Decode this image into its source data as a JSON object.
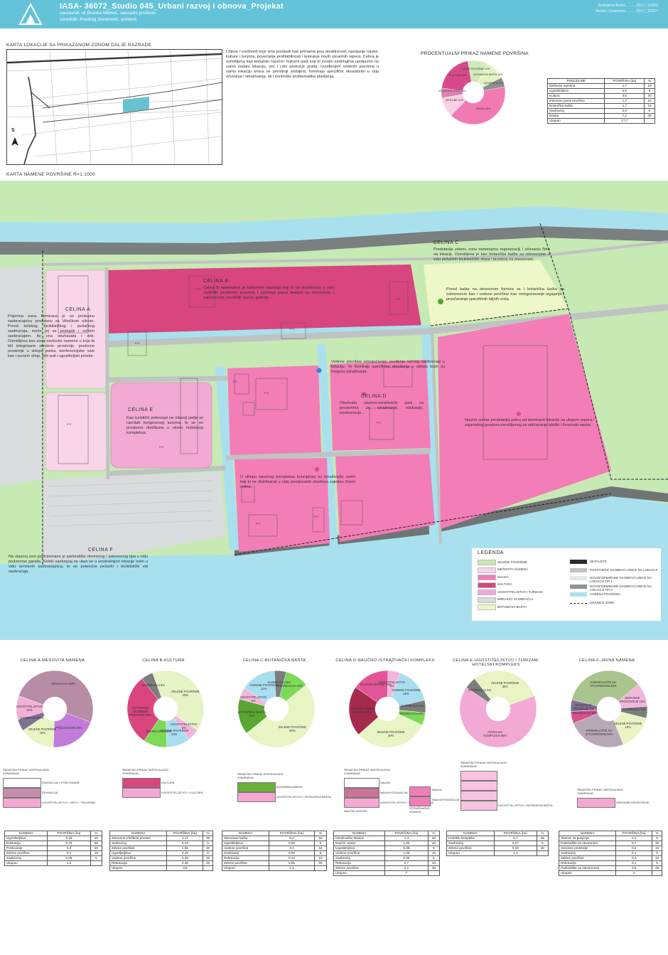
{
  "header": {
    "title": "IASA- 36072_Studio 045_Urbani razvoj i obnova_Projekat",
    "mentor": "nastavnik: dr Branko Mitović, vanredni profesor",
    "assistant": "saradnik: Predrag Jovanović, asistent",
    "author1": "Andrijana Đukić..........2017_12003",
    "author2": "Teodor Jovanović..........2017_12017"
  },
  "section_location": {
    "title": "KARTA LOKACIJE SA PRIKAZANOM ZONOM DALJE RAZRADE",
    "north": "S"
  },
  "intro_text": "Ciljeve i vrednosti koje smo postavili kao primarne jesu atraktivnost, razvijanje nauke, kulture i turizma, povećanje profitabilnosti i kreiranje novih vizuelnih repera. Celina je osmišljena kao tematski naučno- kulturni park koji bi svojim sadržajima upotpunio ne samo zadatu lokaciju, već i celo područje grada. Uvođenjem vodenih površina u samu lokaciju kreira se prirodniji ambijent; formiraju specifični ekosistemi u cilju očuvanja i istraživanja, ali i kontrolše problematika plavljenja.",
  "chart_data": [
    {
      "type": "pie",
      "id": "overall",
      "title": "PROCENTUALNI PRIKAZ NAMENE POVRŠINA",
      "categories": [
        "JAVNE POVRŠINE",
        "BOTANIČKA BAŠTA",
        "SAOBRAĆAJ",
        "NAUKA",
        "MEŠ.UBE",
        "UGOSTITELJSTVO",
        "KULTURA"
      ],
      "values": [
        10,
        10,
        5,
        40,
        10,
        5,
        20
      ],
      "labels": [
        "JAVNE POVRŠINE 10%",
        "BOTANIČKA BAŠTA 10%",
        "SAOBRAĆAJ 5%",
        "NAUKA 40%",
        "MEŠ.UBE 10%",
        "UGOSTITELJSTVO 5%",
        "KULTURA 20%"
      ],
      "colors": [
        "#d3e9b8",
        "#e4f3c4",
        "#8e8f8f",
        "#f27ab3",
        "#f7d0e4",
        "#e07fb0",
        "#d64a8b"
      ]
    },
    {
      "type": "pie",
      "id": "a",
      "title": "CELINA A-MEŠOVITA NAMENA",
      "categories": [
        "EDUKACIJA",
        "POSLOVANJE",
        "ZELENE POVRŠINE",
        "SAOBRAĆAJ",
        "UGOSTITELJSTVO"
      ],
      "values": [
        50,
        20,
        15,
        5,
        10
      ],
      "labels": [
        "EDUKACIJA 50%",
        "POSLOVANJE 20%",
        "ZELENE POVRŠINE 15%",
        "SAOBRAĆAJ 5%",
        "UGOSTITELJSTVO 10%"
      ],
      "colors": [
        "#b78ca5",
        "#c07cd8",
        "#e8f4c3",
        "#7e6f95",
        "#f1b1d7"
      ]
    },
    {
      "type": "pie",
      "id": "b",
      "title": "CELINA B-KULTURA",
      "categories": [
        "ZELENE POVRŠINE",
        "UGOSTITELJSTVO",
        "VODENE POVRŠINE",
        "REKREACIJA",
        "ZATVORENI IZLOŽBENI PROSTORI",
        "SAOBRAĆAJ"
      ],
      "values": [
        40,
        5,
        10,
        10,
        30,
        5
      ],
      "labels": [
        "ZELENE POVRŠINE 40%",
        "UGOSTITELJSTVO 5%",
        "VODENE POVRŠINE 10%",
        "REKREACIJA 10%",
        "ZATVORENI IZLOŽBENI PROSTORI 30%",
        "SAOBRAĆAJ 5%"
      ],
      "colors": [
        "#e6f3c4",
        "#f2b6dd",
        "#a8def0",
        "#7ed957",
        "#d9457f",
        "#7c7d7d"
      ]
    },
    {
      "type": "pie",
      "id": "c",
      "title": "CELINA C-BOTANIČKA BAŠTA",
      "categories": [
        "REKREACIJA",
        "ZELENE POVRŠINE",
        "ZATVORENA BAŠTA",
        "UGOSTITELJSTVO",
        "VODENE POVRŠINE",
        "SAOBRAĆAJ"
      ],
      "values": [
        10,
        50,
        15,
        5,
        15,
        5
      ],
      "labels": [
        "REKREACIJA 10%",
        "ZELENE POVRŠINE 50%",
        "ZATVORENA BAŠTA 15%",
        "UGOSTITELJSTVO 5%",
        "VODENE POVRŠINE 15%",
        "SAOBRAĆAJ 5%"
      ],
      "colors": [
        "#7ed957",
        "#e8f4c3",
        "#5aa632",
        "#f2b6dd",
        "#a8def0",
        "#7c7d7d"
      ]
    },
    {
      "type": "pie",
      "id": "d",
      "title": "CELINA D-NAUČNO-ISTRAŽIVAČKI KOMPLEKS",
      "categories": [
        "VODENE POVRŠINE",
        "SAOBRAĆAJ",
        "REKREACIJA",
        "ZELENE POVRŠINE",
        "ISTRAŽIVAČKE STANICE",
        "NAUČNI CENTAR",
        "UGOSTITELJSTVO"
      ],
      "values": [
        15,
        5,
        5,
        30,
        20,
        15,
        5
      ],
      "labels": [
        "VODENE POVRŠINE 15%",
        "SAOBRAĆAJ 5%",
        "REKREACIJA 5%",
        "ZELENE POVRŠINE 30%",
        "ISTRAŽIVAČKE STANICE 20%",
        "NAUČNI CENTAR 15%",
        "UGOSTITELJSTVO 5%"
      ],
      "colors": [
        "#a8def0",
        "#7c7d7d",
        "#7ed957",
        "#e8f4c3",
        "#a52a4e",
        "#e35597",
        "#f2b6dd"
      ]
    },
    {
      "type": "pie",
      "id": "e",
      "title": "CELINA E-UGOSTITELJSTVO I TURIZAM-HOTELSKI KOMPLEKS",
      "categories": [
        "HOTELSKI KOMPLEKS",
        "SAOBRAĆAJ",
        "ZELENE POVRŠINE"
      ],
      "values": [
        65,
        5,
        30
      ],
      "labels": [
        "HOTELSKI KOMPLEKS 65%",
        "SAOBRAĆAJ 5%",
        "ZELENE POVRŠINE 30%"
      ],
      "colors": [
        "#f2a9d4",
        "#7c7d7d",
        "#e8f4c3"
      ]
    },
    {
      "type": "pie",
      "id": "f",
      "title": "CELINA F-JAVNA NAMENA",
      "categories": [
        "SERVISNE PROSTORIJE",
        "SAOBRAĆAJ",
        "ZELENE POVRŠINE",
        "PARKIRALIŠTE NA ZATVORENOM",
        "REKREACIJA",
        "STANICE ZA PUNJENJE",
        "PARKIRALIŠTE NA OTVORENOM"
      ],
      "values": [
        10,
        5,
        15,
        25,
        5,
        5,
        35
      ],
      "labels": [
        "SERVISNE PROSTORIJE 10%",
        "SAOBRAĆAJ 5%",
        "ZELENE POVRŠINE 15%",
        "PARKIRALIŠTE NA ZATVORENOM 25%",
        "REKREACIJA 5%",
        "STANICE ZA PUNJENJE 5%",
        "PARKIRALIŠTE NA OTVORENOM 40%"
      ],
      "colors": [
        "#f2b6dd",
        "#7c7d7d",
        "#e8f4c3",
        "#b7a8b7",
        "#d74f8d",
        "#7e6f95",
        "#a9c48d"
      ]
    }
  ],
  "overall_table": {
    "headers": [
      "PODCELINE",
      "POVRŠINA (ha)",
      "%"
    ],
    "rows": [
      [
        "Mešovita namena",
        "1,7",
        "10"
      ],
      [
        "Ugostiteljstvo",
        "0,9",
        "5"
      ],
      [
        "Kultura",
        "3,6",
        "20"
      ],
      [
        "Otvorene javne površine",
        "1,7",
        "10"
      ],
      [
        "Botanička bašta",
        "1,7",
        "10"
      ],
      [
        "Saobraćaj",
        "0,9",
        "5"
      ],
      [
        "Nauka",
        "7,2",
        "40"
      ],
      [
        "Ukupno",
        "17,7",
        ""
      ]
    ]
  },
  "section_map": {
    "title": "KARTA NAMENE POVRŠINE R=1:1000"
  },
  "zones": {
    "a": {
      "title": "CELINA A",
      "text": "Prijemna zona formirana je uz pristupnu saobraćajnicu povezanu sa Vilničkom ulicom. Pored kolskog, biciklističkog i pešačkog saobraćaja, može joj se pristupiti i rečnim saobraćajem. Ite ona obuhavata i dok. Osmišljena kao zona mešovite namene u koju bi bili integrisane servisne prostorije, poslovne prostorije u sklopu parka, konferencijske sale kao i suvenir shop, info pult i ugostiteljski prostor."
    },
    "b": {
      "title": "CELINA B",
      "text": "Celina B namenjena je kulturnom sadržaju koji bi se distribuirao u vidu različitih izložbenih prostora i sadržaja poput teatara na otvorenom i zatvorenom, muzičkih scena, galerija..."
    },
    "c": {
      "title": "CELINA C",
      "text": "Predstavlja zelenu zonu namenjenu regeneraciji i očuvanju flore na lokaciji. Osmišljena je kao botanička bašta sa rekreacijom u vidu pešačkih biciklističkih staza i prostora na otvorenom.",
      "text2": "Pored bašte na otvorenom formira se i botanička bašta na zatvorenom kao i vodene površine kao omogućavanje izgajanje i proučavanje specifičnih biljnih vrsta."
    },
    "d": {
      "title": "CELINA D",
      "text": "Obuhvata naučno-istraživački park sa prostorima za istraživanje, edukaciju, konferencije...",
      "text2": "Vodene površine omogućavaju uvođenje rečnog saobraćaja u lokaciju. Te formiraju specifična okruženja u sklopu kojih su moguća istraživanja.",
      "text3": "U sklopu naučnog kompleksa koncipirani su istraživački centri koji bi se distribuirali u vidu paviljonskih struktura zajedno čineći celinu.",
      "text4": "Naučni centar predstavlja jednu od dominanti lokacije sa ulogom repera i sajamskog prostora osmišljenog za održavanje izložbi i Festivala nauke."
    },
    "e": {
      "title": "CELINA E",
      "text": "Kao turistički potencijal na lokaciji javlja se razvitak kongresnog turizma, te se on prostorno distribuira u okviru hotelskog kompleksa."
    },
    "f": {
      "title": "CELINA F",
      "text": "Na ulaznoj zoni pozicionirane je parkiralište otvorenog i zatvorenog tipa u vidu podzemne garaže. Kolski saobraćaj ne ulazi se u unutrašnjost lokacije osim u vidu servisnih saobraćajnica, te se potencira pešački i biciklistički vid saobraćaja."
    }
  },
  "map_labels": {
    "p1": "P+1",
    "p2": "P+2"
  },
  "legend": {
    "title": "LEGENDA",
    "items": [
      {
        "label": "ZELENE POVRŠINE",
        "color": "#c7e9b4"
      },
      {
        "label": "MEŠOVITA NAMENA",
        "color": "#f8d5e8"
      },
      {
        "label": "NAUKA",
        "color": "#f37db6"
      },
      {
        "label": "KULTURA",
        "color": "#d9457f"
      },
      {
        "label": "UGOSTITELJSTVO I TURIZAM",
        "color": "#f2a9d4"
      },
      {
        "label": "MIRUJUĆI SAOBRAĆAJ",
        "color": "#d9dcdc"
      },
      {
        "label": "BOTANIČKA BAŠTA",
        "color": "#eef7c8"
      }
    ],
    "items2": [
      {
        "label": "ŠETALIŠTE",
        "color": "#2b2b2b"
      },
      {
        "label": "POSTOJEĆE SAOBRAĆAJNICE NA LOKACIJI",
        "color": "#bfc3c3"
      },
      {
        "label": "NOVOFORMIRANE SAOBRAĆAJNICE NA LOKACIJI TIP 1",
        "color": "#e3e6e6"
      },
      {
        "label": "NOVOFORMIRANE SAOBRAĆAJNICE NA LOKACIJI TIP 2",
        "color": "#8f9494"
      },
      {
        "label": "VODENA POVRŠINA",
        "color": "#a9e0ee"
      },
      {
        "label": "GRANICE ZONE",
        "color": "dash"
      }
    ]
  },
  "sections": [
    {
      "heading": "ŠEMATSKI PRIKAZ VERTIKALNOG ZONIRANJA",
      "boxes": [
        {
          "label": "EDUKACIJA + POSLOVANJE",
          "color": "#ffffff"
        },
        {
          "label": "EDUKACIJA",
          "color": "#c48eac"
        },
        {
          "label": "UGOSTITELJSTVO + INFO + TRGOVINA",
          "color": "#f4a8d2"
        }
      ]
    },
    {
      "heading": "ŠEMATSKI PRIKAZ VERTIKALNOG ZONIRANJA",
      "boxes": [
        {
          "label": "KULTURA",
          "color": "#d9457f"
        },
        {
          "label": "UGOSTITELJSTVO + KULTURA",
          "color": "#f4a8d2"
        }
      ]
    },
    {
      "heading": "ŠEMATSKI PRIKAZ VERTIKALNOG ZONIRANJA",
      "boxes": [
        {
          "label": "BOTANIČKA BAŠTA",
          "color": "#6ab237"
        },
        {
          "label": "UGOSTITELJSTVO + BOTANIČKA BAŠTA",
          "color": "#f4a8d2"
        }
      ]
    },
    {
      "heading": "ŠEMATSKI PRIKAZ VERTIKALNOG ZONIRANJA",
      "boxes": [
        {
          "label": "NAUKA",
          "color": "#ffffff"
        },
        {
          "label": "NAUKA+EDUKACIJA",
          "color": "#c97397"
        },
        {
          "label": "UGOSTITELJSTVO + INFO + TRGOVINA",
          "color": "#f4a8d2"
        }
      ],
      "extra": [
        {
          "label": "NAUKA",
          "color": "#f37db6"
        },
        {
          "label": "NAUKA+EDUKACIJA",
          "color": "#f37db6"
        }
      ],
      "sub": [
        "NAUČNI CENTAR",
        "ISTRAŽIVAČKE STANICE"
      ]
    },
    {
      "heading": "ŠEMATSKI PRIKAZ VERTIKALNOG ZONIRANJA",
      "boxes": [
        {
          "label": "",
          "color": "#f8c3e0"
        },
        {
          "label": "",
          "color": "#f8c3e0"
        },
        {
          "label": "",
          "color": "#f8c3e0"
        },
        {
          "label": "UGOSTITELJSTVO + BOTANIČKA BAŠTA",
          "color": "#f8c3e0"
        }
      ]
    },
    {
      "heading": "ŠEMATSKI PRIKAZ VERTIKALNOG ZONIRANJA",
      "boxes": [
        {
          "label": "SERVISNE PROSTORIJE",
          "color": "#f4a8d2"
        }
      ]
    }
  ],
  "tables": [
    {
      "headers": [
        "NAMENA",
        "POVRŠINA (ha)",
        "%"
      ],
      "rows": [
        [
          "Ugostiteljstvo",
          "0,15",
          "10"
        ],
        [
          "Edukacija",
          "0,75",
          "50"
        ],
        [
          "Poslovanje",
          "0,3",
          "20"
        ],
        [
          "Zelene površine",
          "0,2",
          "15"
        ],
        [
          "Saobraćaj",
          "0,08",
          "5"
        ],
        [
          "Ukupno",
          "1,5",
          ""
        ]
      ]
    },
    {
      "headers": [
        "NAMENA",
        "POVRŠINA (ha)",
        "%"
      ],
      "rows": [
        [
          "Zatvoreni izložbeni prostori",
          "1,17",
          "30"
        ],
        [
          "Saobraćaj",
          "0,19",
          "5"
        ],
        [
          "Zelene površine",
          "1,56",
          "40"
        ],
        [
          "Ugostiteljstvo",
          "0,19",
          "5"
        ],
        [
          "Vodene površine",
          "0,39",
          "10"
        ],
        [
          "Rekreacija",
          "0,39",
          "10"
        ],
        [
          "Ukupno",
          "3,9",
          ""
        ]
      ]
    },
    {
      "headers": [
        "NAMENA",
        "POVRŠINA (ha)",
        "%"
      ],
      "rows": [
        [
          "Zatvorena bašta",
          "0,2",
          "15"
        ],
        [
          "Ugostiteljstvo",
          "0,06",
          "5"
        ],
        [
          "Vodene površine",
          "0,2",
          "15"
        ],
        [
          "Saobraćaj",
          "0,06",
          "5"
        ],
        [
          "Rekreacija",
          "0,13",
          "10"
        ],
        [
          "Zelene površine",
          "0,65",
          "50"
        ],
        [
          "Ukupno",
          "1,3",
          ""
        ]
      ]
    },
    {
      "headers": [
        "NAMENA",
        "POVRŠINA (ha)",
        "%"
      ],
      "rows": [
        [
          "Istraživačke stanice",
          "1,4",
          "20"
        ],
        [
          "Naučni centar",
          "1,05",
          "15"
        ],
        [
          "Ugostiteljstvo",
          "0,35",
          "5"
        ],
        [
          "Vodene površine",
          "1,05",
          "15"
        ],
        [
          "Saobraćaj",
          "0,35",
          "5"
        ],
        [
          "Rekreacija",
          "0,7",
          "10"
        ],
        [
          "Zelene površine",
          "2,1",
          "30"
        ],
        [
          "Ukupno",
          "7",
          ""
        ]
      ]
    },
    {
      "headers": [
        "NAMENA",
        "POVRŠINA (ha)",
        "%"
      ],
      "rows": [
        [
          "Hotelski kompleks",
          "0,7",
          "65"
        ],
        [
          "Saobraćaj",
          "0,07",
          "5"
        ],
        [
          "Zelene površine",
          "0,33",
          "30"
        ],
        [
          "Ukupno",
          "1,1",
          ""
        ]
      ]
    },
    {
      "headers": [
        "NAMENA",
        "POVRŠINA (ha)",
        "%"
      ],
      "rows": [
        [
          "Stanice za punjenje",
          "0,1",
          "5"
        ],
        [
          "Parkiralište na otvorenom",
          "0,7",
          "35"
        ],
        [
          "Servisne prostorije",
          "0,2",
          "10"
        ],
        [
          "Saobraćaj",
          "0,1",
          "5"
        ],
        [
          "Zelene površine",
          "0,3",
          "15"
        ],
        [
          "Rekreacija",
          "0,1",
          "5"
        ],
        [
          "Parkiralište na zatvorenom",
          "0,5",
          "25"
        ],
        [
          "Ukupno",
          "2",
          ""
        ]
      ]
    }
  ]
}
